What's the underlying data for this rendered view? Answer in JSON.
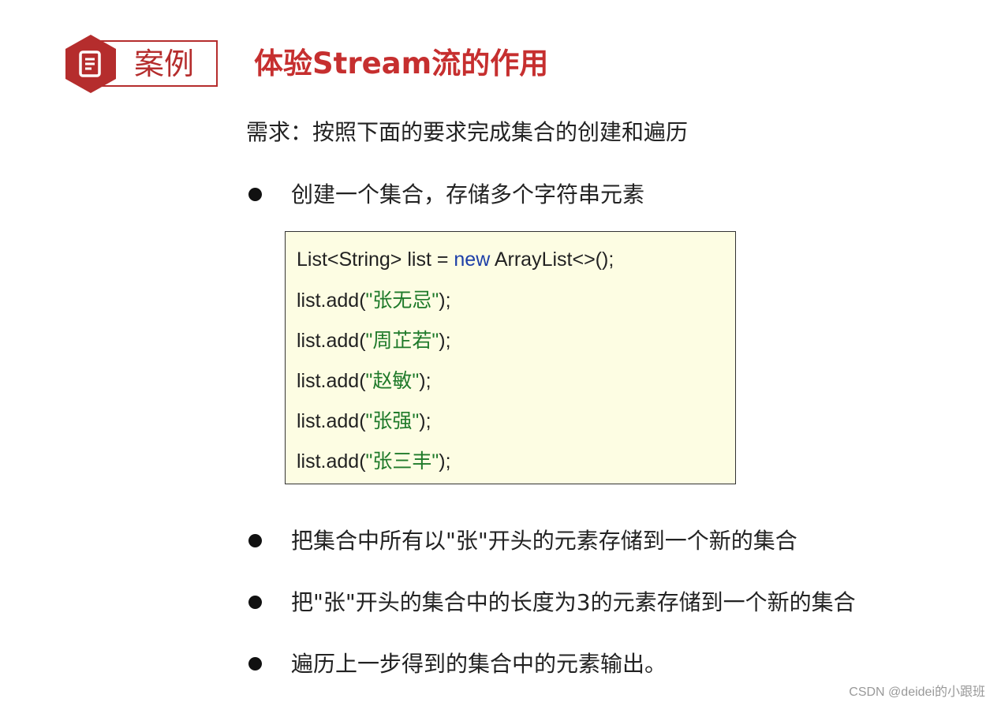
{
  "header": {
    "badge_icon": "document-icon",
    "badge_color": "#b52d2d",
    "case_label": "案例",
    "title": "体验Stream流的作用"
  },
  "requirement": "需求：按照下面的要求完成集合的创建和遍历",
  "bullets": [
    "创建一个集合，存储多个字符串元素",
    "把集合中所有以\"张\"开头的元素存储到一个新的集合",
    "把\"张\"开头的集合中的长度为3的元素存储到一个新的集合",
    "遍历上一步得到的集合中的元素输出。"
  ],
  "code": {
    "line1_prefix": "List<String> list = ",
    "line1_keyword": "new",
    "line1_suffix": " ArrayList<>();",
    "add_prefix": "list.add(",
    "add_suffix": ");",
    "strings": [
      "\"张无忌\"",
      "\"周芷若\"",
      "\"赵敏\"",
      "\"张强\"",
      "\"张三丰\""
    ],
    "colors": {
      "keyword": "#1d3fa8",
      "string": "#1f7a2a",
      "background": "#fdfde3"
    }
  },
  "watermark": "CSDN @deidei的小跟班"
}
